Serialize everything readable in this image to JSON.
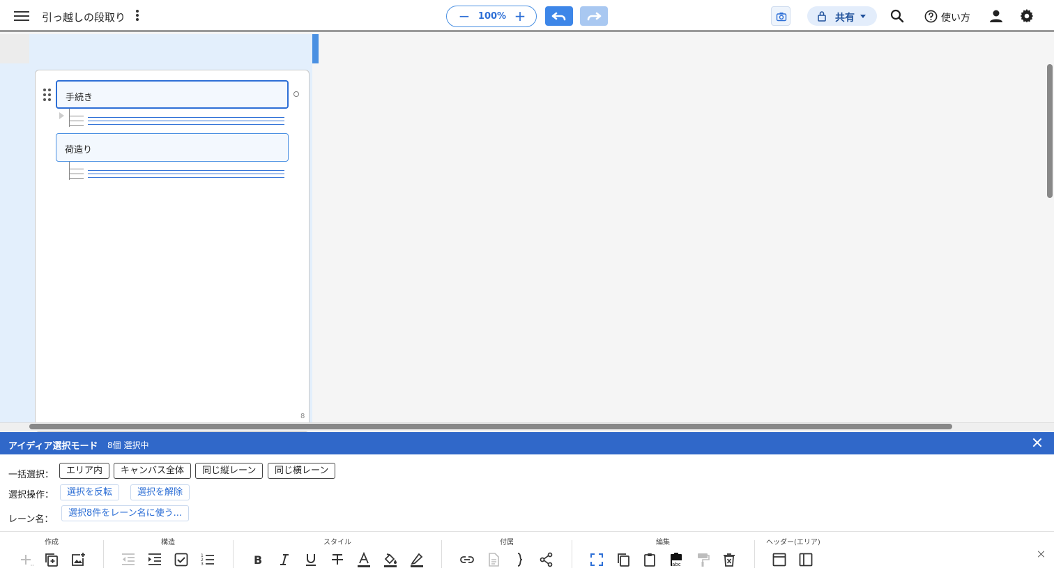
{
  "header": {
    "title": "引っ越しの段取り",
    "zoom": "100%",
    "zoom_minus": "−",
    "zoom_plus": "+",
    "share_label": "共有",
    "help_label": "使い方"
  },
  "canvas": {
    "cards": [
      {
        "label": "手続き",
        "selected": true
      },
      {
        "label": "荷造り",
        "selected": false
      }
    ],
    "area_count": "8"
  },
  "selection_mode": {
    "title": "アイディア選択モード",
    "count": "8個 選択中",
    "bulk_label": "一括選択：",
    "bulk_buttons": [
      "エリア内",
      "キャンバス全体",
      "同じ縦レーン",
      "同じ横レーン"
    ],
    "ops_label": "選択操作：",
    "ops_buttons": [
      "選択を反転",
      "選択を解除"
    ],
    "lane_label": "レーン名：",
    "lane_button": "選択8件をレーン名に使う..."
  },
  "toolbar": {
    "groups": [
      "作成",
      "構造",
      "スタイル",
      "付属",
      "編集",
      "ヘッダー(エリア)"
    ],
    "icons": {
      "create": [
        "add-icon",
        "duplicate-icon",
        "add-image-icon"
      ],
      "structure": [
        "outdent-icon",
        "indent-icon",
        "checkbox-icon",
        "numbered-list-icon"
      ],
      "style": [
        "bold-icon",
        "italic-icon",
        "underline-icon",
        "strikethrough-icon",
        "text-color-icon",
        "fill-color-icon",
        "highlighter-icon"
      ],
      "attach": [
        "link-icon",
        "document-icon",
        "brace-icon",
        "share-node-icon"
      ],
      "edit": [
        "select-frame-icon",
        "copy-icon",
        "paste-icon",
        "paste-text-icon",
        "format-paint-icon",
        "delete-icon"
      ],
      "header": [
        "header-row-icon",
        "header-column-icon"
      ]
    }
  },
  "colors": {
    "accent": "#2d6fd6",
    "mode_bar": "#3068c9",
    "lane_bg": "#e3effc"
  }
}
